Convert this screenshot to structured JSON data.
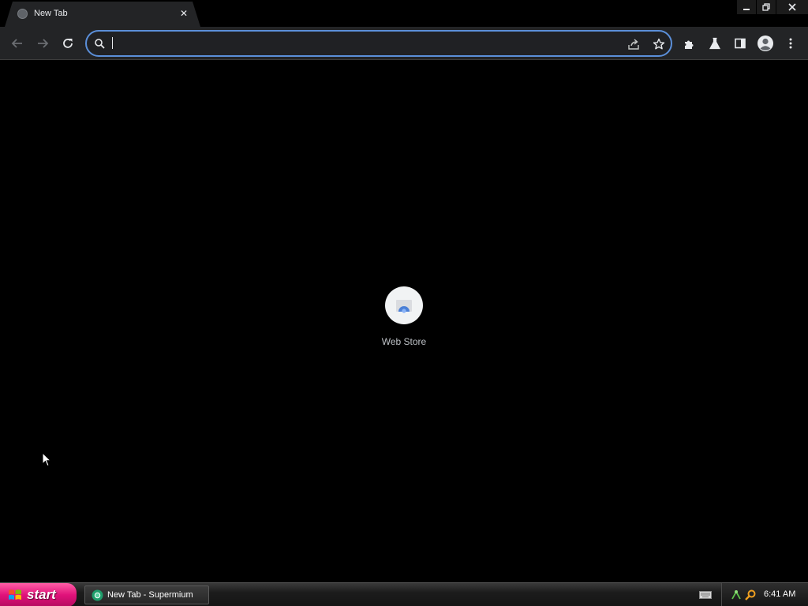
{
  "browser": {
    "tab": {
      "title": "New Tab",
      "close_glyph": "✕",
      "favicon": "globe-icon"
    },
    "window_controls": [
      "minimize-icon",
      "restore-icon",
      "close-icon"
    ],
    "toolbar": {
      "nav_icons": [
        "back-arrow-icon",
        "forward-arrow-icon",
        "reload-icon"
      ],
      "omnibox": {
        "value": "",
        "placeholder": "",
        "icons": [
          "search-icon",
          "share-icon",
          "star-icon"
        ]
      },
      "action_icons": [
        "extensions-icon",
        "labs-icon",
        "side-panel-icon",
        "profile-avatar-icon",
        "menu-dots-icon"
      ]
    },
    "content": {
      "shortcuts": [
        {
          "label": "Web Store",
          "icon": "web-store-icon"
        }
      ]
    },
    "colors": {
      "accent": "#5b8fd9",
      "toolbar": "#232426",
      "background": "#000000"
    }
  },
  "taskbar": {
    "start_label": "start",
    "task_item": {
      "label": "New Tab - Supermium",
      "icon": "supermium-icon"
    },
    "tray_icons": [
      "keyboard-icon",
      "network-icon",
      "search-tray-icon"
    ],
    "clock": "6:41 AM",
    "colors": {
      "start": "#e0127a"
    }
  }
}
